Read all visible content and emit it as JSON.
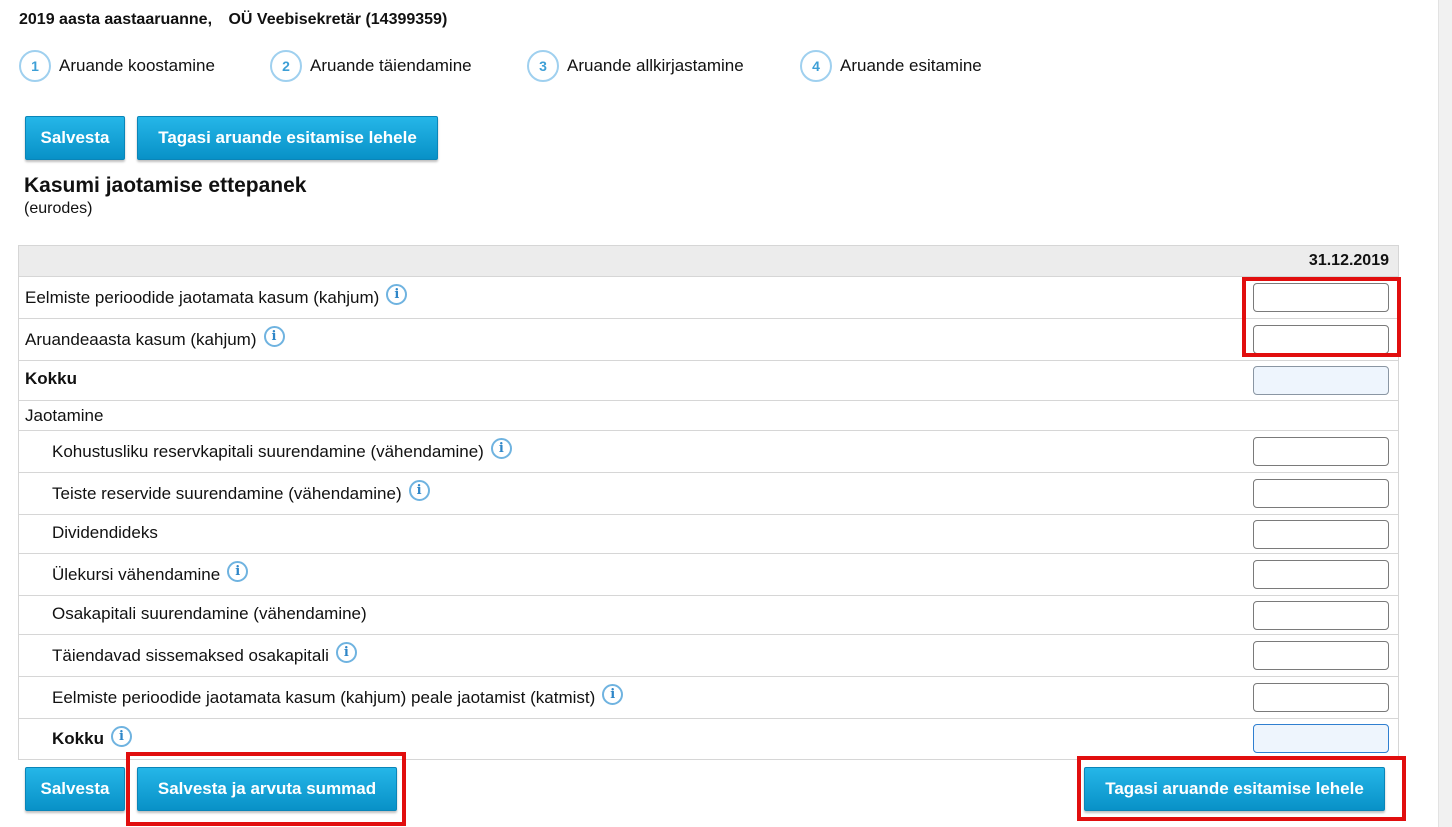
{
  "header": {
    "report_title": "2019 aasta aastaaruanne,",
    "company": "OÜ Veebisekretär (14399359)"
  },
  "steps": [
    {
      "number": "1",
      "label": "Aruande koostamine"
    },
    {
      "number": "2",
      "label": "Aruande täiendamine"
    },
    {
      "number": "3",
      "label": "Aruande allkirjastamine"
    },
    {
      "number": "4",
      "label": "Aruande esitamine"
    }
  ],
  "toolbar": {
    "save_label": "Salvesta",
    "back_label": "Tagasi aruande esitamise lehele"
  },
  "section": {
    "title": "Kasumi jaotamise ettepanek",
    "unit": "(eurodes)"
  },
  "table": {
    "column_header": "31.12.2019",
    "rows": [
      {
        "label": "Eelmiste perioodide jaotamata kasum (kahjum)",
        "value": ""
      },
      {
        "label": "Aruandeaasta kasum (kahjum)",
        "value": ""
      },
      {
        "label": "Kokku",
        "value": ""
      },
      {
        "label": "Jaotamine"
      },
      {
        "label": "Kohustusliku reservkapitali suurendamine (vähendamine)",
        "value": ""
      },
      {
        "label": "Teiste reservide suurendamine (vähendamine)",
        "value": ""
      },
      {
        "label": "Dividendideks",
        "value": ""
      },
      {
        "label": "Ülekursi vähendamine",
        "value": ""
      },
      {
        "label": "Osakapitali suurendamine (vähendamine)",
        "value": ""
      },
      {
        "label": "Täiendavad sissemaksed osakapitali",
        "value": ""
      },
      {
        "label": "Eelmiste perioodide jaotamata kasum (kahjum) peale jaotamist (katmist)",
        "value": ""
      },
      {
        "label": "Kokku",
        "value": ""
      }
    ]
  },
  "footer": {
    "save_label": "Salvesta",
    "save_calc_label": "Salvesta ja arvuta summad",
    "back_label": "Tagasi aruande esitamise lehele"
  },
  "icons": {
    "info": "i",
    "info_icon_name": "info-icon"
  },
  "colors": {
    "button_blue": "#0891c7",
    "highlight_red": "#e10e0e",
    "step_circle": "#9fd0ef"
  }
}
